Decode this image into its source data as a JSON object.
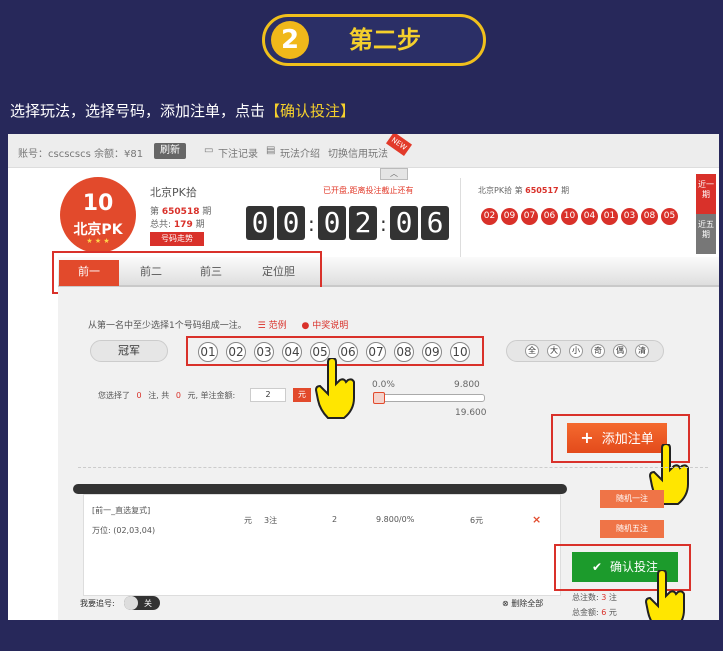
{
  "step": {
    "number": "2",
    "label": "第二步"
  },
  "intro": {
    "text": "选择玩法，选择号码，添加注单，点击",
    "highlight": "【确认投注】"
  },
  "topbar": {
    "account": "账号：cscscscs",
    "balance": "余额：¥81",
    "refresh": "刷新",
    "records": "下注记录",
    "rules": "玩法介绍",
    "switch": "切换信用玩法",
    "new_tag": "NEW"
  },
  "lottery": {
    "logo_number": "10",
    "logo_text": "北京PK",
    "name": "北京PK拾",
    "issue_prefix": "第",
    "issue": "650518",
    "issue_suffix": "期",
    "total_prefix": "总共:",
    "total": "179",
    "total_suffix": "期",
    "trend": "号码走势"
  },
  "countdown": {
    "notice": "已开盘,距离投注截止还有",
    "digits": [
      "0",
      "0",
      "0",
      "2",
      "0",
      "6"
    ]
  },
  "last_draw": {
    "name": "北京PK拾",
    "issue_prefix": "第",
    "issue": "650517",
    "issue_suffix": "期",
    "balls": [
      "02",
      "09",
      "07",
      "06",
      "10",
      "04",
      "01",
      "03",
      "08",
      "05"
    ]
  },
  "side_buttons": [
    "近一期",
    "近五期"
  ],
  "tabs": [
    "前一",
    "前二",
    "前三",
    "定位胆"
  ],
  "hint": {
    "text": "从第一名中至少选择1个号码组成一注。",
    "example": "范例",
    "prize": "中奖说明"
  },
  "row_label": "冠军",
  "numbers": [
    "01",
    "02",
    "03",
    "04",
    "05",
    "06",
    "07",
    "08",
    "09",
    "10"
  ],
  "filters": [
    "全",
    "大",
    "小",
    "奇",
    "偶",
    "清"
  ],
  "selection": {
    "prefix": "您选择了",
    "count": "0",
    "mid1": "注, 共",
    "amount": "0",
    "mid2": "元, 单注金额:",
    "unit_value": "2",
    "unit_button": "元",
    "rebate_min": "0.0%",
    "odds_max": "9.800",
    "odds_current": "19.600"
  },
  "add_button": "添加注单",
  "bet": {
    "title": "[前一_直选复式]",
    "detail": "万位: (02,03,04)",
    "unit": "元",
    "count": "3注",
    "multiple": "2",
    "odds": "9.800/0%",
    "amount": "6元",
    "remove": "×"
  },
  "random1": "随机一注",
  "random5": "随机五注",
  "confirm": "确认投注",
  "summary": {
    "total_count_label": "总注数:",
    "total_count": "3",
    "total_count_unit": "注",
    "total_amount_label": "总金额:",
    "total_amount": "6",
    "total_amount_unit": "元"
  },
  "chase": {
    "label": "我要追号:",
    "toggle": "关"
  },
  "delete_all": "删除全部",
  "colors": {
    "accent": "#e24a2c",
    "confirm": "#1c9b2c",
    "badge": "#f0c01c",
    "page_bg": "#27285a"
  }
}
